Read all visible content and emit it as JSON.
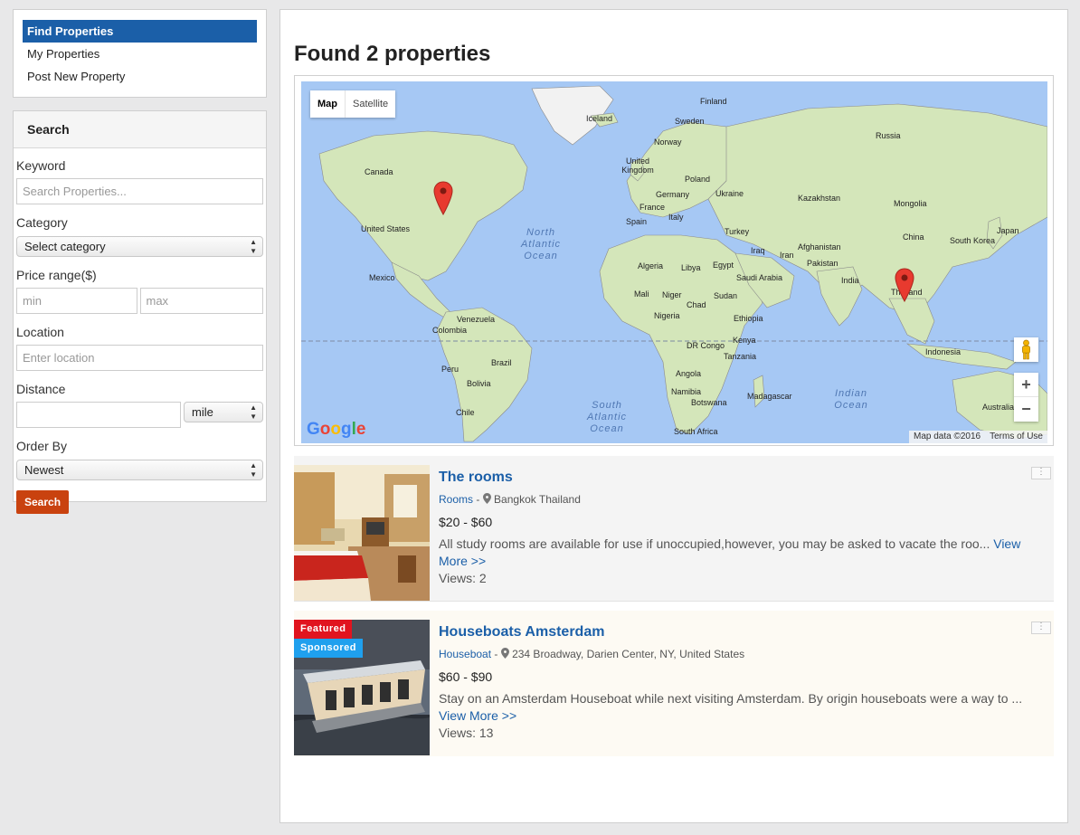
{
  "nav": {
    "items": [
      {
        "label": "Find Properties",
        "active": true
      },
      {
        "label": "My Properties",
        "active": false
      },
      {
        "label": "Post New Property",
        "active": false
      }
    ]
  },
  "search": {
    "title": "Search",
    "keyword_label": "Keyword",
    "keyword_placeholder": "Search Properties...",
    "category_label": "Category",
    "category_value": "Select category",
    "price_label": "Price range($)",
    "min_placeholder": "min",
    "max_placeholder": "max",
    "location_label": "Location",
    "location_placeholder": "Enter location",
    "distance_label": "Distance",
    "distance_unit": "mile",
    "order_label": "Order By",
    "order_value": "Newest",
    "button": "Search"
  },
  "main": {
    "title": "Found 2 properties"
  },
  "map": {
    "type_map": "Map",
    "type_satellite": "Satellite",
    "zoom_in": "+",
    "zoom_out": "−",
    "attribution": "Map data ©2016",
    "terms": "Terms of Use",
    "logo": "Google",
    "labels": {
      "finland": "Finland",
      "iceland": "Iceland",
      "sweden": "Sweden",
      "russia": "Russia",
      "norway": "Norway",
      "uk": "United Kingdom",
      "poland": "Poland",
      "germany": "Germany",
      "ukraine": "Ukraine",
      "kazakhstan": "Kazakhstan",
      "france": "France",
      "italy": "Italy",
      "spain": "Spain",
      "mongolia": "Mongolia",
      "turkey": "Turkey",
      "china": "China",
      "south_korea": "South Korea",
      "japan": "Japan",
      "canada": "Canada",
      "united_states": "United States",
      "iraq": "Iraq",
      "iran": "Iran",
      "afghanistan": "Afghanistan",
      "pakistan": "Pakistan",
      "algeria": "Algeria",
      "libya": "Libya",
      "egypt": "Egypt",
      "saudi_arabia": "Saudi Arabia",
      "india": "India",
      "mexico": "Mexico",
      "mali": "Mali",
      "niger": "Niger",
      "sudan": "Sudan",
      "chad": "Chad",
      "thailand": "Thailand",
      "nigeria": "Nigeria",
      "ethiopia": "Ethiopia",
      "venezuela": "Venezuela",
      "colombia": "Colombia",
      "kenya": "Kenya",
      "dr_congo": "DR Congo",
      "indonesia": "Indonesia",
      "tanzania": "Tanzania",
      "peru": "Peru",
      "brazil": "Brazil",
      "angola": "Angola",
      "bolivia": "Bolivia",
      "namibia": "Namibia",
      "madagascar": "Madagascar",
      "botswana": "Botswana",
      "australia": "Australia",
      "chile": "Chile",
      "south_africa": "South Africa"
    },
    "oceans": {
      "north_atlantic": "North Atlantic Ocean",
      "south_atlantic": "South Atlantic Ocean",
      "indian": "Indian Ocean"
    }
  },
  "listings": [
    {
      "title": "The rooms",
      "category": "Rooms",
      "location": "Bangkok Thailand",
      "price": "$20 - $60",
      "description": "All study rooms are available for use if unoccupied,however, you may be asked to vacate the roo...",
      "more": "View More >>",
      "views": "Views: 2",
      "badges": []
    },
    {
      "title": "Houseboats Amsterdam",
      "category": "Houseboat",
      "location": "234 Broadway, Darien Center, NY, United States",
      "price": "$60 - $90",
      "description": "Stay on an Amsterdam Houseboat while next visiting Amsterdam. By origin houseboats were a way to ...",
      "more": "View More >>",
      "views": "Views: 13",
      "badges": [
        "Featured",
        "Sponsored"
      ]
    }
  ],
  "colors": {
    "primary": "#1b5fa8",
    "search_button": "#c9420f",
    "featured": "#e1141f",
    "sponsored": "#1fa0ee",
    "water": "#a6c8f4",
    "land": "#cfe3b4"
  }
}
